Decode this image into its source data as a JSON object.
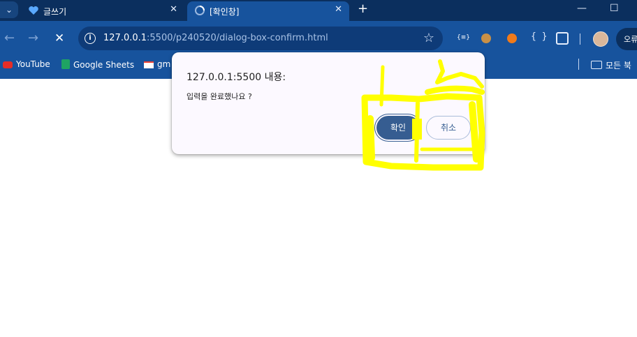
{
  "tabs": [
    {
      "title": "글쓰기",
      "active": false
    },
    {
      "title": "[확인창]",
      "active": true
    }
  ],
  "tab_close_glyph": "✕",
  "new_tab_glyph": "+",
  "window_controls": {
    "minimize": "—",
    "maximize": "☐"
  },
  "address_bar": {
    "host": "127.0.0.1",
    "rest": ":5500/p240520/dialog-box-confirm.html"
  },
  "nav": {
    "back": "←",
    "forward": "→",
    "stop": "✕"
  },
  "extensions": {
    "first": "{≡}",
    "braces": "{ }"
  },
  "error_button_label": "오류",
  "bookmarks": [
    {
      "label": "YouTube",
      "icon": "youtube-icon"
    },
    {
      "label": "Google Sheets",
      "icon": "sheets-icon"
    },
    {
      "label": "gm",
      "icon": "gmail-icon"
    }
  ],
  "all_bookmarks_label": "모든 북",
  "dialog": {
    "title": "127.0.0.1:5500 내용:",
    "message": "입력을 완료했나요 ?",
    "ok_label": "확인",
    "cancel_label": "취소"
  },
  "colors": {
    "tabstrip": "#0b2f5e",
    "toolbar": "#17539d",
    "dialog_bg": "#fcf9ff",
    "button_primary": "#365d91",
    "highlight_scribble": "#ffff00"
  }
}
